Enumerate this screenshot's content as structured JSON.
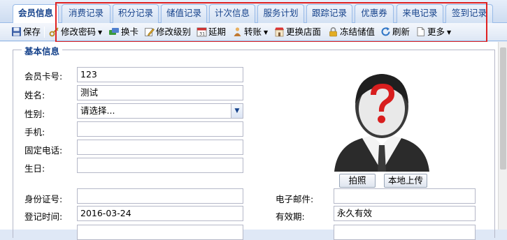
{
  "tabs": [
    {
      "label": "会员信息",
      "active": true
    },
    {
      "label": "消费记录"
    },
    {
      "label": "积分记录"
    },
    {
      "label": "储值记录"
    },
    {
      "label": "计次信息"
    },
    {
      "label": "服务计划"
    },
    {
      "label": "跟踪记录"
    },
    {
      "label": "优惠券"
    },
    {
      "label": "来电记录"
    },
    {
      "label": "签到记录"
    }
  ],
  "toolbar": {
    "save": "保存",
    "change_password": "修改密码",
    "swap_card": "换卡",
    "change_level": "修改级别",
    "extend": "延期",
    "transfer": "转账",
    "change_store": "更换店面",
    "freeze_balance": "冻结储值",
    "refresh": "刷新",
    "more": "更多"
  },
  "form": {
    "section_title": "基本信息",
    "card_no": {
      "label": "会员卡号:",
      "value": "123"
    },
    "name": {
      "label": "姓名:",
      "value": "测试"
    },
    "gender": {
      "label": "性别:",
      "value": "请选择..."
    },
    "mobile": {
      "label": "手机:",
      "value": ""
    },
    "phone": {
      "label": "固定电话:",
      "value": ""
    },
    "birthday": {
      "label": "生日:",
      "value": ""
    },
    "id_no": {
      "label": "身份证号:",
      "value": ""
    },
    "email": {
      "label": "电子邮件:",
      "value": ""
    },
    "register_time": {
      "label": "登记时间:",
      "value": "2016-03-24"
    },
    "valid_until": {
      "label": "有效期:",
      "value": "永久有效"
    }
  },
  "photo": {
    "take_photo": "拍照",
    "upload_local": "本地上传"
  },
  "icons": [
    "save-icon",
    "key-icon",
    "swap-card-icon",
    "edit-level-icon",
    "calendar-icon",
    "transfer-icon",
    "store-icon",
    "lock-icon",
    "refresh-icon",
    "more-icon",
    "unknown-avatar-icon"
  ],
  "colors": {
    "highlight": "#e02020",
    "tab_text": "#15428b"
  }
}
